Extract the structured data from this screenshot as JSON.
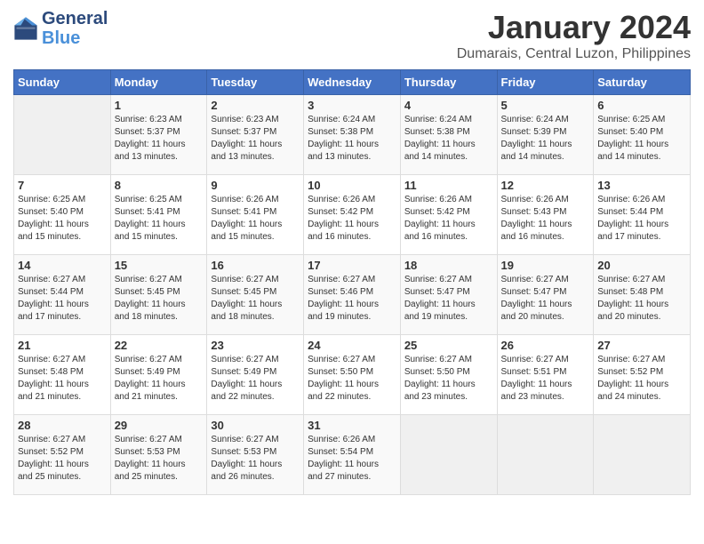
{
  "header": {
    "logo_line1": "General",
    "logo_line2": "Blue",
    "month_title": "January 2024",
    "subtitle": "Dumarais, Central Luzon, Philippines"
  },
  "days_of_week": [
    "Sunday",
    "Monday",
    "Tuesday",
    "Wednesday",
    "Thursday",
    "Friday",
    "Saturday"
  ],
  "weeks": [
    [
      {
        "day": "",
        "content": ""
      },
      {
        "day": "1",
        "content": "Sunrise: 6:23 AM\nSunset: 5:37 PM\nDaylight: 11 hours\nand 13 minutes."
      },
      {
        "day": "2",
        "content": "Sunrise: 6:23 AM\nSunset: 5:37 PM\nDaylight: 11 hours\nand 13 minutes."
      },
      {
        "day": "3",
        "content": "Sunrise: 6:24 AM\nSunset: 5:38 PM\nDaylight: 11 hours\nand 13 minutes."
      },
      {
        "day": "4",
        "content": "Sunrise: 6:24 AM\nSunset: 5:38 PM\nDaylight: 11 hours\nand 14 minutes."
      },
      {
        "day": "5",
        "content": "Sunrise: 6:24 AM\nSunset: 5:39 PM\nDaylight: 11 hours\nand 14 minutes."
      },
      {
        "day": "6",
        "content": "Sunrise: 6:25 AM\nSunset: 5:40 PM\nDaylight: 11 hours\nand 14 minutes."
      }
    ],
    [
      {
        "day": "7",
        "content": "Sunrise: 6:25 AM\nSunset: 5:40 PM\nDaylight: 11 hours\nand 15 minutes."
      },
      {
        "day": "8",
        "content": "Sunrise: 6:25 AM\nSunset: 5:41 PM\nDaylight: 11 hours\nand 15 minutes."
      },
      {
        "day": "9",
        "content": "Sunrise: 6:26 AM\nSunset: 5:41 PM\nDaylight: 11 hours\nand 15 minutes."
      },
      {
        "day": "10",
        "content": "Sunrise: 6:26 AM\nSunset: 5:42 PM\nDaylight: 11 hours\nand 16 minutes."
      },
      {
        "day": "11",
        "content": "Sunrise: 6:26 AM\nSunset: 5:42 PM\nDaylight: 11 hours\nand 16 minutes."
      },
      {
        "day": "12",
        "content": "Sunrise: 6:26 AM\nSunset: 5:43 PM\nDaylight: 11 hours\nand 16 minutes."
      },
      {
        "day": "13",
        "content": "Sunrise: 6:26 AM\nSunset: 5:44 PM\nDaylight: 11 hours\nand 17 minutes."
      }
    ],
    [
      {
        "day": "14",
        "content": "Sunrise: 6:27 AM\nSunset: 5:44 PM\nDaylight: 11 hours\nand 17 minutes."
      },
      {
        "day": "15",
        "content": "Sunrise: 6:27 AM\nSunset: 5:45 PM\nDaylight: 11 hours\nand 18 minutes."
      },
      {
        "day": "16",
        "content": "Sunrise: 6:27 AM\nSunset: 5:45 PM\nDaylight: 11 hours\nand 18 minutes."
      },
      {
        "day": "17",
        "content": "Sunrise: 6:27 AM\nSunset: 5:46 PM\nDaylight: 11 hours\nand 19 minutes."
      },
      {
        "day": "18",
        "content": "Sunrise: 6:27 AM\nSunset: 5:47 PM\nDaylight: 11 hours\nand 19 minutes."
      },
      {
        "day": "19",
        "content": "Sunrise: 6:27 AM\nSunset: 5:47 PM\nDaylight: 11 hours\nand 20 minutes."
      },
      {
        "day": "20",
        "content": "Sunrise: 6:27 AM\nSunset: 5:48 PM\nDaylight: 11 hours\nand 20 minutes."
      }
    ],
    [
      {
        "day": "21",
        "content": "Sunrise: 6:27 AM\nSunset: 5:48 PM\nDaylight: 11 hours\nand 21 minutes."
      },
      {
        "day": "22",
        "content": "Sunrise: 6:27 AM\nSunset: 5:49 PM\nDaylight: 11 hours\nand 21 minutes."
      },
      {
        "day": "23",
        "content": "Sunrise: 6:27 AM\nSunset: 5:49 PM\nDaylight: 11 hours\nand 22 minutes."
      },
      {
        "day": "24",
        "content": "Sunrise: 6:27 AM\nSunset: 5:50 PM\nDaylight: 11 hours\nand 22 minutes."
      },
      {
        "day": "25",
        "content": "Sunrise: 6:27 AM\nSunset: 5:50 PM\nDaylight: 11 hours\nand 23 minutes."
      },
      {
        "day": "26",
        "content": "Sunrise: 6:27 AM\nSunset: 5:51 PM\nDaylight: 11 hours\nand 23 minutes."
      },
      {
        "day": "27",
        "content": "Sunrise: 6:27 AM\nSunset: 5:52 PM\nDaylight: 11 hours\nand 24 minutes."
      }
    ],
    [
      {
        "day": "28",
        "content": "Sunrise: 6:27 AM\nSunset: 5:52 PM\nDaylight: 11 hours\nand 25 minutes."
      },
      {
        "day": "29",
        "content": "Sunrise: 6:27 AM\nSunset: 5:53 PM\nDaylight: 11 hours\nand 25 minutes."
      },
      {
        "day": "30",
        "content": "Sunrise: 6:27 AM\nSunset: 5:53 PM\nDaylight: 11 hours\nand 26 minutes."
      },
      {
        "day": "31",
        "content": "Sunrise: 6:26 AM\nSunset: 5:54 PM\nDaylight: 11 hours\nand 27 minutes."
      },
      {
        "day": "",
        "content": ""
      },
      {
        "day": "",
        "content": ""
      },
      {
        "day": "",
        "content": ""
      }
    ]
  ]
}
